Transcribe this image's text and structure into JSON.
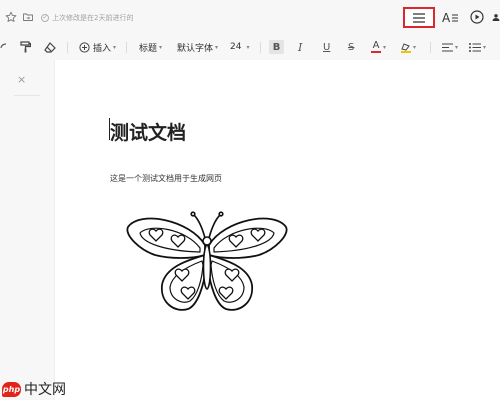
{
  "topbar": {
    "status_text": "上次修改是在2天前进行的"
  },
  "toolbar": {
    "insert_label": "插入",
    "heading_label": "标题",
    "font_label": "默认字体",
    "size_label": "24",
    "bold_glyph": "B",
    "italic_glyph": "I",
    "underline_glyph": "U",
    "strike_glyph": "S",
    "font_color_glyph": "A",
    "font_color": "#d9282f",
    "highlight_color": "#f0c400"
  },
  "document": {
    "title": "测试文档",
    "body": "这是一个测试文档用于生成网页"
  },
  "watermark": {
    "logo_text": "php",
    "text": "中文网"
  },
  "colors": {
    "accent_red": "#d9282f"
  }
}
